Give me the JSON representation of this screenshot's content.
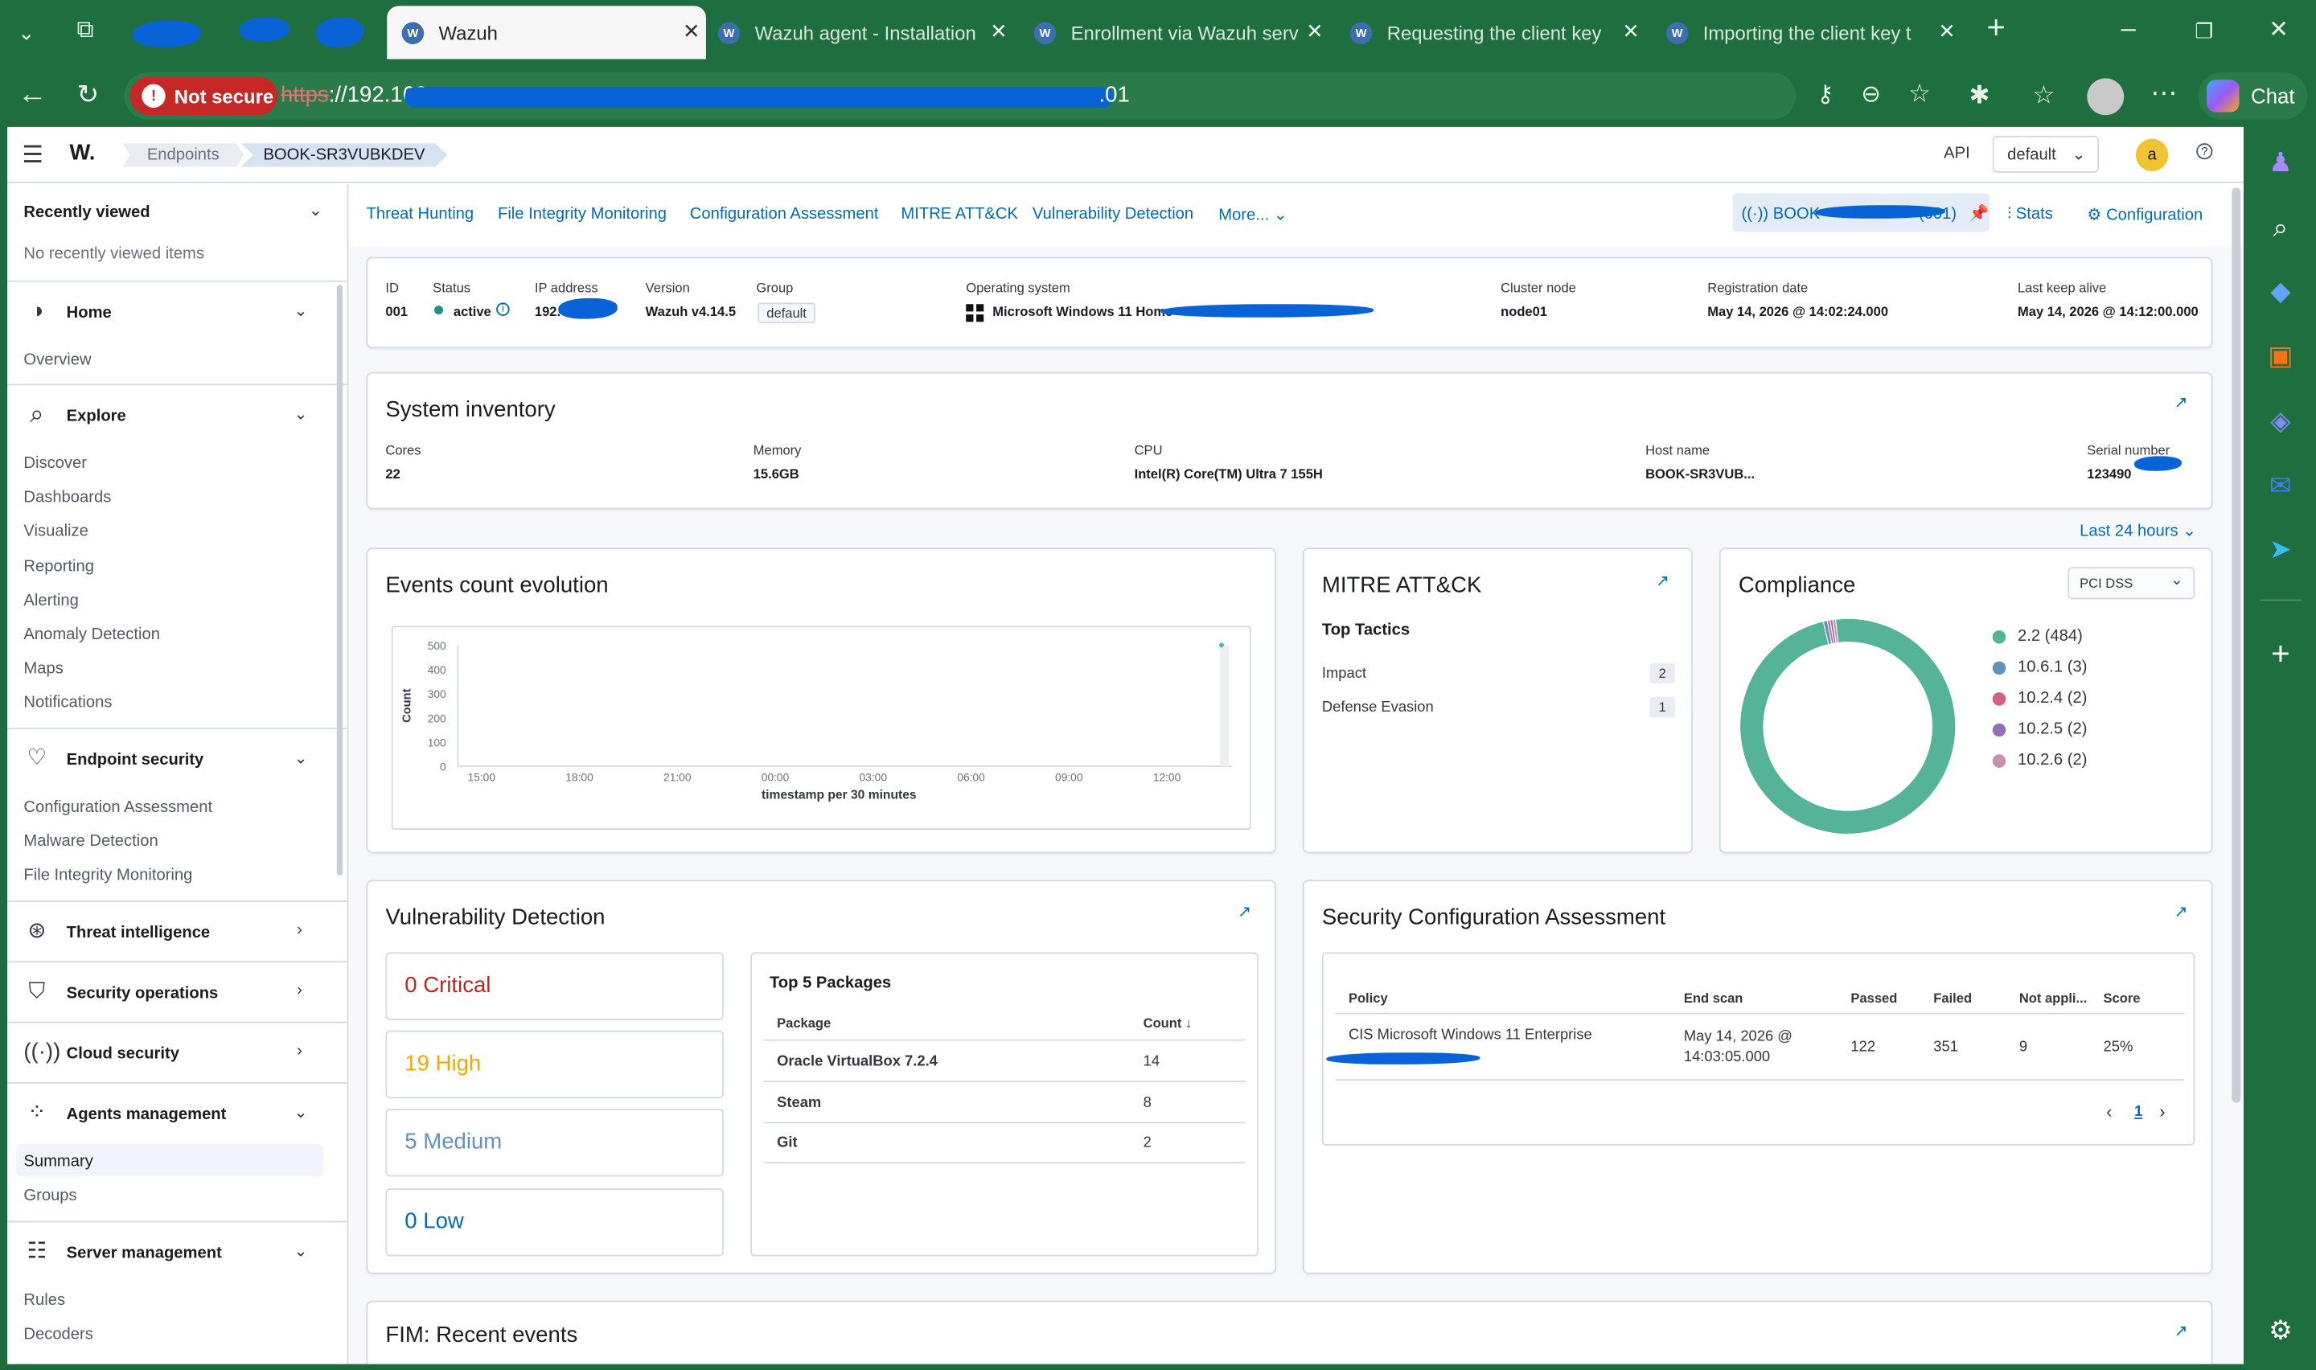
{
  "browser": {
    "tabs": [
      {
        "label": "Wazuh",
        "active": true
      },
      {
        "label": "Wazuh agent - Installation",
        "active": false
      },
      {
        "label": "Enrollment via Wazuh serv",
        "active": false
      },
      {
        "label": "Requesting the client key",
        "active": false
      },
      {
        "label": "Importing the client key t",
        "active": false
      }
    ],
    "not_secure": "Not secure",
    "url_scheme": "https",
    "url_rest": "://192.168.",
    "url_tail": ".01",
    "chat_label": "Chat"
  },
  "app": {
    "logo": "W.",
    "breadcrumb": [
      "Endpoints",
      "BOOK-SR3VUBKDEV"
    ],
    "api_label": "API",
    "tenant": "default",
    "avatar": "a",
    "help_icon": "help-icon"
  },
  "sidebar": {
    "recent_title": "Recently viewed",
    "recent_empty": "No recently viewed items",
    "home": {
      "label": "Home",
      "items": [
        "Overview"
      ]
    },
    "explore": {
      "label": "Explore",
      "items": [
        "Discover",
        "Dashboards",
        "Visualize",
        "Reporting",
        "Alerting",
        "Anomaly Detection",
        "Maps",
        "Notifications"
      ]
    },
    "endpoint_security": {
      "label": "Endpoint security",
      "items": [
        "Configuration Assessment",
        "Malware Detection",
        "File Integrity Monitoring"
      ]
    },
    "threat_intelligence": "Threat intelligence",
    "security_operations": "Security operations",
    "cloud_security": "Cloud security",
    "agents_management": {
      "label": "Agents management",
      "items": [
        "Summary",
        "Groups"
      ],
      "selected": "Summary"
    },
    "server_management": {
      "label": "Server management",
      "items": [
        "Rules",
        "Decoders"
      ]
    }
  },
  "module_tabs": [
    "Threat Hunting",
    "File Integrity Monitoring",
    "Configuration Assessment",
    "MITRE ATT&CK",
    "Vulnerability Detection",
    "More..."
  ],
  "agent_actions": {
    "agent_pill_prefix": "BOOK",
    "agent_pill_suffix": "(001)",
    "stats": "Stats",
    "configuration": "Configuration"
  },
  "agent_info": {
    "fields": [
      {
        "label": "ID",
        "value": "001"
      },
      {
        "label": "Status",
        "value": "active"
      },
      {
        "label": "IP address",
        "value": "192."
      },
      {
        "label": "Version",
        "value": "Wazuh v4.14.5"
      },
      {
        "label": "Group",
        "value": "default"
      },
      {
        "label": "Operating system",
        "value": "Microsoft Windows 11 Home"
      },
      {
        "label": "Cluster node",
        "value": "node01"
      },
      {
        "label": "Registration date",
        "value": "May 14, 2026 @ 14:02:24.000"
      },
      {
        "label": "Last keep alive",
        "value": "May 14, 2026 @ 14:12:00.000"
      }
    ]
  },
  "inventory": {
    "title": "System inventory",
    "fields": [
      {
        "label": "Cores",
        "value": "22"
      },
      {
        "label": "Memory",
        "value": "15.6GB"
      },
      {
        "label": "CPU",
        "value": "Intel(R) Core(TM) Ultra 7 155H"
      },
      {
        "label": "Host name",
        "value": "BOOK-SR3VUB..."
      },
      {
        "label": "Serial number",
        "value": "123490"
      }
    ]
  },
  "time_range": "Last 24 hours",
  "events": {
    "title": "Events count evolution"
  },
  "chart_data": {
    "type": "line",
    "ylabel": "Count",
    "xlabel": "timestamp per 30 minutes",
    "y_ticks": [
      "500",
      "400",
      "300",
      "200",
      "100",
      "0"
    ],
    "ylim": [
      0,
      500
    ],
    "x_ticks": [
      "15:00",
      "18:00",
      "21:00",
      "00:00",
      "03:00",
      "06:00",
      "09:00",
      "12:00"
    ],
    "series": [
      {
        "x": [
          "14:00"
        ],
        "values": [
          500
        ]
      }
    ],
    "color": "#54b399"
  },
  "mitre": {
    "title": "MITRE ATT&CK",
    "subtitle": "Top Tactics",
    "rows": [
      {
        "label": "Impact",
        "count": "2"
      },
      {
        "label": "Defense Evasion",
        "count": "1"
      }
    ]
  },
  "compliance": {
    "title": "Compliance",
    "select": "PCI DSS",
    "legend": [
      {
        "label": "2.2 (484)",
        "value": 484,
        "color": "#54b399"
      },
      {
        "label": "10.6.1 (3)",
        "value": 3,
        "color": "#6092c0"
      },
      {
        "label": "10.2.4 (2)",
        "value": 2,
        "color": "#d36086"
      },
      {
        "label": "10.2.5 (2)",
        "value": 2,
        "color": "#9170b8"
      },
      {
        "label": "10.2.6 (2)",
        "value": 2,
        "color": "#ca8eae"
      }
    ]
  },
  "vulnerability": {
    "title": "Vulnerability Detection",
    "critical": "0 Critical",
    "high": "19 High",
    "medium": "5 Medium",
    "low": "0 Low",
    "packages_title": "Top 5 Packages",
    "col_package": "Package",
    "col_count": "Count",
    "packages": [
      {
        "name": "Oracle VirtualBox 7.2.4",
        "count": "14"
      },
      {
        "name": "Steam",
        "count": "8"
      },
      {
        "name": "Git",
        "count": "2"
      }
    ]
  },
  "sca": {
    "title": "Security Configuration Assessment",
    "cols": [
      "Policy",
      "End scan",
      "Passed",
      "Failed",
      "Not appli...",
      "Score"
    ],
    "row": {
      "policy": "CIS Microsoft Windows 11 Enterprise",
      "end_scan_1": "May 14, 2026 @",
      "end_scan_2": "14:03:05.000",
      "passed": "122",
      "failed": "351",
      "na": "9",
      "score": "25%"
    },
    "page": "1"
  },
  "fim": {
    "title": "FIM: Recent events"
  }
}
